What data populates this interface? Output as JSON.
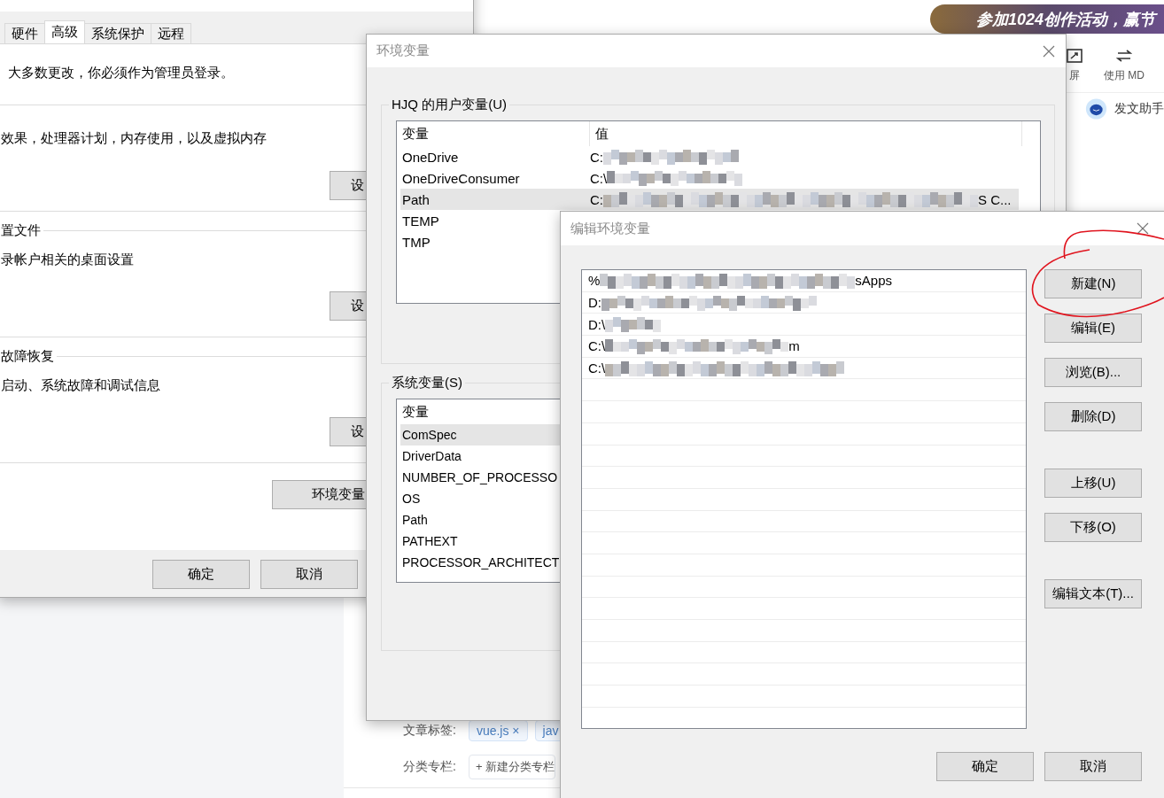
{
  "background_page": {
    "banner": "参加1024创作活动，赢节",
    "toolbar": [
      {
        "kind": "fullscreen",
        "label": "屏"
      },
      {
        "kind": "swap",
        "label": "使用 MD"
      }
    ],
    "assistant": "发文助手",
    "tags_label": "文章标签:",
    "tags": [
      {
        "label": "vue.js",
        "remove": "×"
      },
      {
        "label": "jav"
      }
    ],
    "column_label": "分类专栏:",
    "new_column_button": "+ 新建分类专栏"
  },
  "system_properties": {
    "tabs": [
      {
        "label": "硬件",
        "selected": false
      },
      {
        "label": "高级",
        "selected": true
      },
      {
        "label": "系统保护",
        "selected": false
      },
      {
        "label": "远程",
        "selected": false
      }
    ],
    "admin_note": "大多数更改，你必须作为管理员登录。",
    "sections": [
      {
        "description": "效果，处理器计划，内存使用，以及虚拟内存",
        "button": "设"
      },
      {
        "title": "置文件",
        "description": "录帐户相关的桌面设置",
        "button": "设"
      },
      {
        "title": "故障恢复",
        "description": "启动、系统故障和调试信息",
        "button": "设"
      }
    ],
    "env_button": "环境变量",
    "buttons": [
      "确定",
      "取消"
    ]
  },
  "env_window": {
    "title": "环境变量",
    "user_group": {
      "legend": "HJQ 的用户变量(U)",
      "columns": [
        "变量",
        "值"
      ],
      "rows": [
        {
          "name": "OneDrive",
          "value": {
            "start": "C:"
          },
          "selected": false
        },
        {
          "name": "OneDriveConsumer",
          "value": {
            "start": "C:\\"
          },
          "selected": false
        },
        {
          "name": "Path",
          "value": {
            "start": "C:",
            "end": "S C..."
          },
          "selected": true
        },
        {
          "name": "TEMP",
          "selected": false
        },
        {
          "name": "TMP",
          "selected": false
        }
      ]
    },
    "system_group": {
      "legend": "系统变量(S)",
      "columns": [
        "变量"
      ],
      "rows": [
        {
          "name": "ComSpec",
          "selected": true
        },
        {
          "name": "DriverData",
          "selected": false
        },
        {
          "name": "NUMBER_OF_PROCESSO",
          "selected": false
        },
        {
          "name": "OS",
          "selected": false
        },
        {
          "name": "Path",
          "selected": false
        },
        {
          "name": "PATHEXT",
          "selected": false
        },
        {
          "name": "PROCESSOR_ARCHITECT",
          "selected": false
        }
      ]
    }
  },
  "edit_window": {
    "title": "编辑环境变量",
    "entries": [
      {
        "start": "%",
        "end": "sApps"
      },
      {
        "start": "D:"
      },
      {
        "start": "D:\\"
      },
      {
        "start": "C:\\",
        "end": "m"
      },
      {
        "start": "C:\\"
      }
    ],
    "side_buttons": [
      [
        "新建(N)",
        "编辑(E)",
        "浏览(B)...",
        "删除(D)"
      ],
      [
        "上移(U)",
        "下移(O)"
      ],
      [
        "编辑文本(T)..."
      ]
    ],
    "buttons": [
      "确定",
      "取消"
    ]
  }
}
